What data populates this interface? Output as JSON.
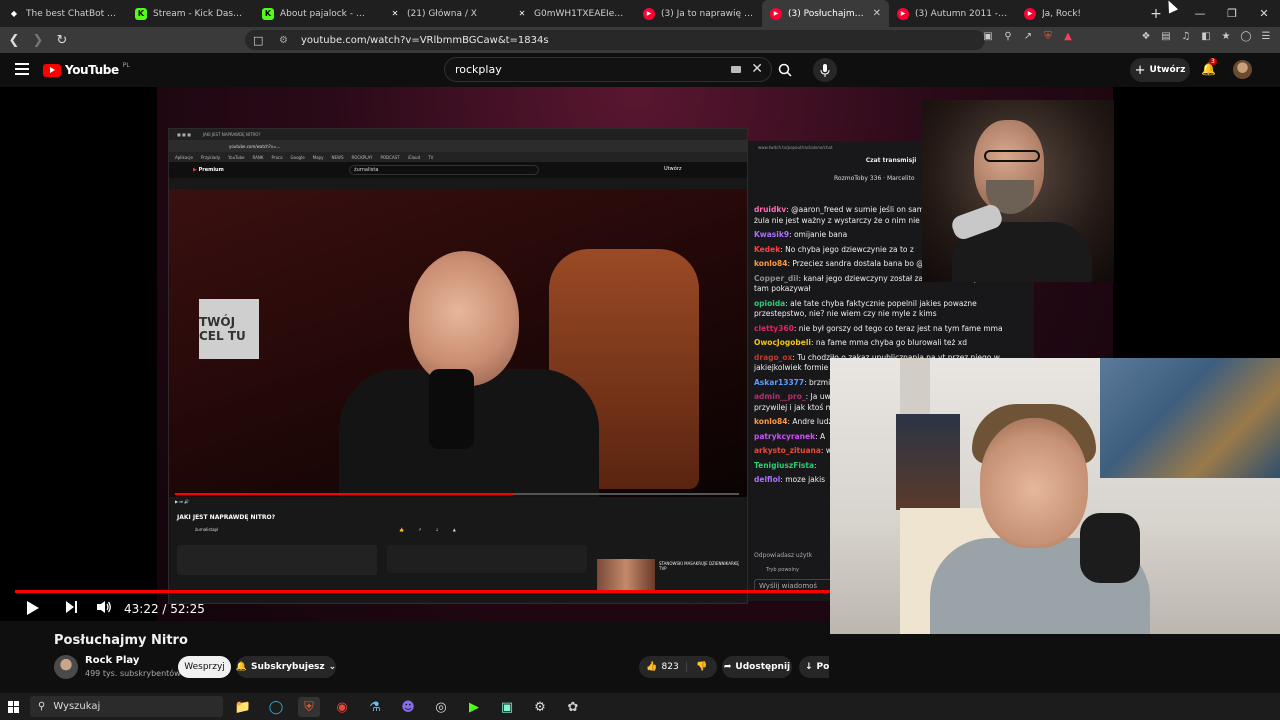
{
  "browser": {
    "tabs": [
      {
        "label": "The best ChatBot and Wid",
        "favicon": "bot",
        "color": "#ffffff"
      },
      {
        "label": "Stream - Kick Dashboa",
        "favicon": "kick",
        "color": "#53fc18"
      },
      {
        "label": "About pajalock - Watch Li",
        "favicon": "kick",
        "color": "#53fc18"
      },
      {
        "label": "(21) Główna / X",
        "favicon": "x",
        "color": "#ffffff"
      },
      {
        "label": "G0mWH1TXEAEIeaz (593×",
        "favicon": "x",
        "color": "#ffffff"
      },
      {
        "label": "(3) Ja to naprawię - YouTu",
        "favicon": "youtube",
        "color": "#ff0033"
      },
      {
        "label": "(3) Posłuchajmy Nitro",
        "favicon": "youtube",
        "color": "#ff0033",
        "active": true
      },
      {
        "label": "(3) Autumn 2011 - YouTu",
        "favicon": "youtube",
        "color": "#ff0033"
      },
      {
        "label": "Ja, Rock!",
        "favicon": "youtube-music",
        "color": "#ff0033"
      }
    ],
    "url": "youtube.com/watch?v=VRlbmmBGCaw&t=1834s"
  },
  "youtube": {
    "logo_text": "YouTube",
    "country_code": "PL",
    "search_value": "rockplay",
    "create_label": "Utwórz",
    "notification_count": "3"
  },
  "player": {
    "current_time": "43:22",
    "duration": "52:25",
    "progress": 0.827
  },
  "stream": {
    "inner_search": "żurnalista",
    "inner_title": "JAKI JEST NAPRAWDĘ NITRO?",
    "inner_channel": "żurnalistapl",
    "inner_premium": "Premium",
    "inner_sign": "TWÓJ CEL TU",
    "inner_thumb_title": "STANOWSKI MASAKRUJE DZIENNIKARKĘ TVP",
    "twitch_url": "www.twitch.tv/popout/rockalone/chat",
    "chat_title": "Czat transmisji",
    "chat_gift": "RozmoToby 336 · Marcelito",
    "chat_messages": [
      {
        "user": "druidkv",
        "color": "#ff69b4",
        "text": "@aaron_freed w sumie jeśli on sam ze sobą to faktycznie to żula nie jest ważny z wystarczy że o nim nie pomyśl"
      },
      {
        "user": "Kwasik9",
        "color": "#a970ff",
        "text": "omijanie bana"
      },
      {
        "user": "Kedek",
        "color": "#ff4040",
        "text": "No chyba jego dziewczynie za to z"
      },
      {
        "user": "konlo84",
        "color": "#ff9a3c",
        "text": "Przeciez sandra dostala bana bo @RockAlone"
      },
      {
        "user": "Copper_dil",
        "color": "#8c8c8c",
        "text": "kanał jego dziewczyny został za to zbanowany bo sie Nitro tam pokazywał"
      },
      {
        "user": "opioida",
        "color": "#2ecc71",
        "text": "ale tate chyba faktycznie popelnil jakies powazne przestepstwo, nie? nie wiem czy nie myle z kims"
      },
      {
        "user": "cletty360",
        "color": "#e0245e",
        "text": "nie był gorszy od tego co teraz jest na tym fame mma"
      },
      {
        "user": "OwocJogobeli",
        "color": "#f0c419",
        "text": "na fame mma chyba go blurowali też xd"
      },
      {
        "user": "drago_ox",
        "color": "#c0392b",
        "text": "Tu chodziło o zakaz upublicznania na yt przez niego w jakiejkolwiek formie"
      },
      {
        "user": "Askar13377",
        "color": "#5c9cff",
        "text": "brzmi absurdalnie ale takie są fakty"
      },
      {
        "user": "admin__pro_",
        "color": "#b0306e",
        "text": "Ja uważam, że bycie w internecie to powinien być przywilej i jak ktoś ma rzeczy za uszami to out."
      },
      {
        "user": "konlo84",
        "color": "#ff9a3c",
        "text": "Andre ludzmi te sprawy"
      },
      {
        "user": "patrykcyranek",
        "color": "#d04cff",
        "text": "A"
      },
      {
        "user": "arkysto_zituana",
        "color": "#e74c3c",
        "text": "wię"
      },
      {
        "user": "TenigiuszFista",
        "color": "#2ecc71",
        "text": ""
      },
      {
        "user": "delfiol",
        "color": "#a970ff",
        "text": "moze jakis"
      }
    ],
    "chat_reply_hint": "Odpowiadasz użytk",
    "chat_pending": "Tryb powolny",
    "chat_placeholder": "Wyślij wiadomoś"
  },
  "video_info": {
    "title": "Posłuchajmy Nitro",
    "channel": "Rock Play",
    "subscribers": "499 tys. subskrybentów",
    "support_label": "Wesprzyj",
    "subscribe_label": "Subskrybujesz",
    "likes": "823",
    "share_label": "Udostępnij",
    "download_label": "Pobierz"
  },
  "taskbar": {
    "search_placeholder": "Wyszukaj"
  },
  "colors": {
    "youtube_red": "#ff0000",
    "twitch_bg": "#18181b"
  }
}
